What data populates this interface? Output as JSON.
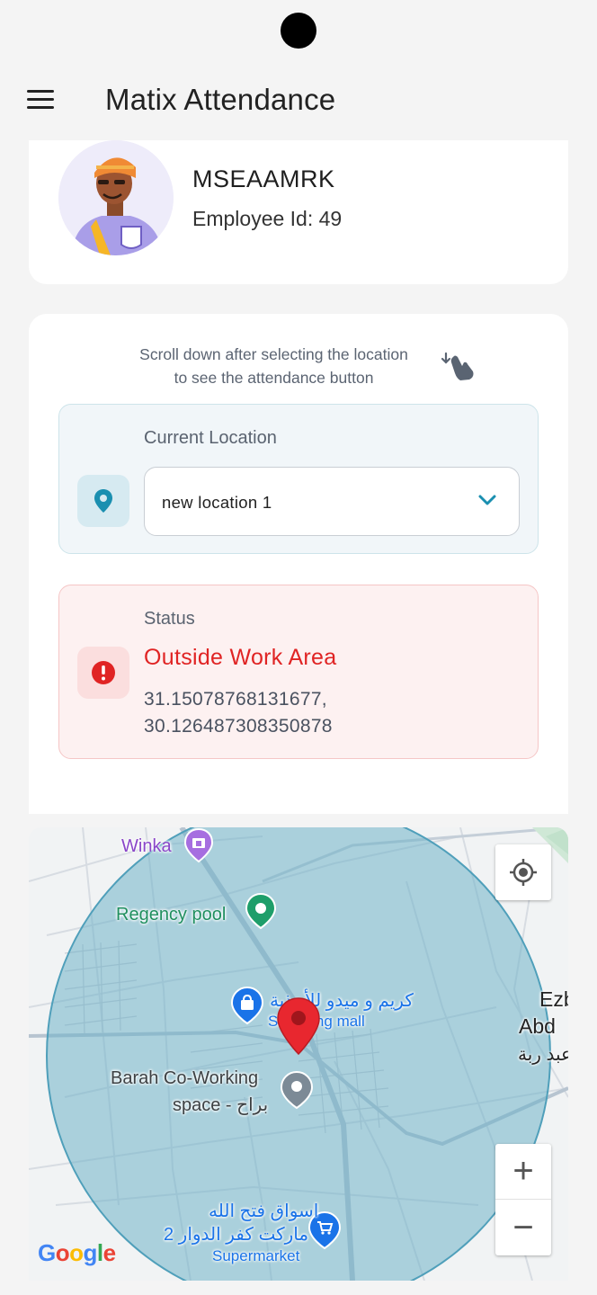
{
  "app": {
    "title": "Matix Attendance"
  },
  "profile": {
    "name": "MSEAAMRK",
    "employee_id_label": "Employee Id:",
    "employee_id": "49"
  },
  "location_card": {
    "hint_line1": "Scroll down after selecting the location",
    "hint_line2": "to see the attendance button",
    "current_location_label": "Current Location",
    "selected_location": "new location 1"
  },
  "status": {
    "label": "Status",
    "value": "Outside Work Area",
    "latitude": "31.15078768131677,",
    "longitude": "30.126487308350878"
  },
  "map": {
    "labels": {
      "winka": "Winka",
      "regency_pool": "Regency pool",
      "karim_midu": "كريم و ميدو للأحذية",
      "shopping_mall": "Shopping mall",
      "barah_line1": "Barah Co-Working",
      "barah_line2": "space - براح",
      "ezb": "Ezb",
      "abd": "Abd",
      "abd_ar": "عبد ربة",
      "aswaq_line1": "اسواق فتح الله",
      "aswaq_line2": "ماركت كفر الدوار 2",
      "supermarket": "Supermarket"
    },
    "zoom_in": "+",
    "zoom_out": "−",
    "google": [
      "G",
      "o",
      "o",
      "g",
      "l",
      "e"
    ]
  },
  "colors": {
    "accent": "#1a8fb0",
    "status_error": "#e02424",
    "geofence_fill": "#6fb3c9",
    "marker": "#e8272f"
  }
}
